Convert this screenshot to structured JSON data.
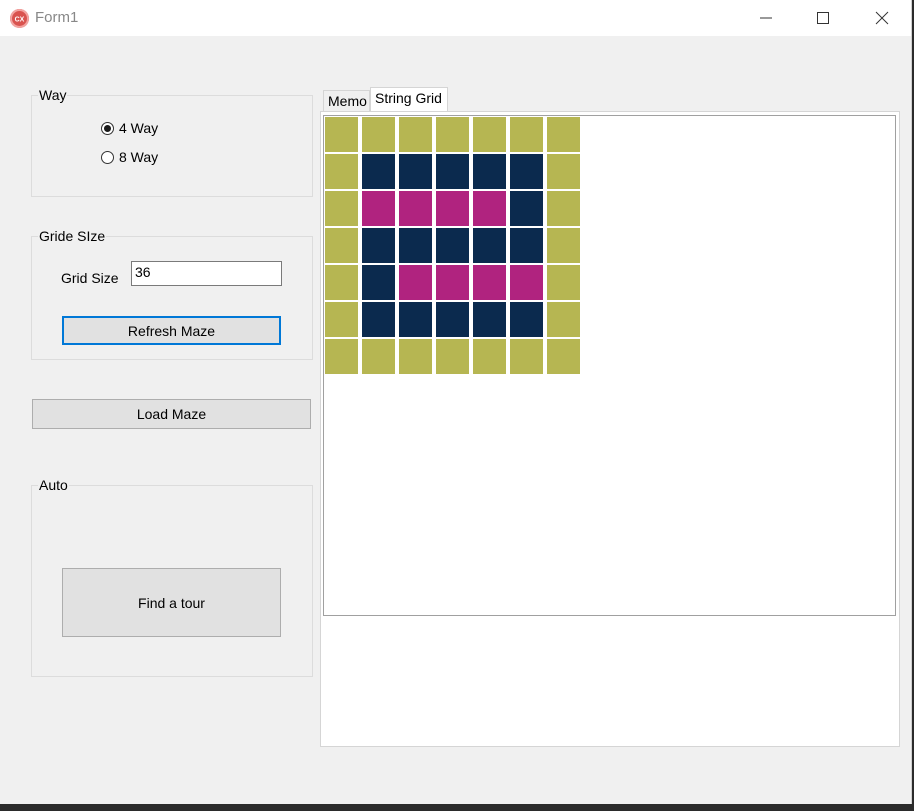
{
  "window": {
    "title": "Form1",
    "icon": "cx-app-icon"
  },
  "controls": {
    "minimize": "minimize-icon",
    "maximize": "maximize-icon",
    "close": "close-icon"
  },
  "way_group": {
    "label": "Way",
    "options": [
      {
        "label": "4 Way",
        "selected": true
      },
      {
        "label": "8 Way",
        "selected": false
      }
    ]
  },
  "size_group": {
    "label": "Gride SIze",
    "field_label": "Grid Size",
    "field_value": "36",
    "refresh_label": "Refresh Maze"
  },
  "load_label": "Load Maze",
  "auto_group": {
    "label": "Auto",
    "find_label": "Find a tour"
  },
  "tabs": [
    {
      "label": "Memo",
      "active": false
    },
    {
      "label": "String Grid",
      "active": true
    }
  ],
  "colors": {
    "wall": "#b6b652",
    "path": "#0b2a4e",
    "visited": "#b0237f",
    "accent": "#0078d7"
  },
  "maze": [
    [
      "W",
      "W",
      "W",
      "W",
      "W",
      "W",
      "W"
    ],
    [
      "W",
      "P",
      "P",
      "P",
      "P",
      "P",
      "W"
    ],
    [
      "W",
      "V",
      "V",
      "V",
      "V",
      "P",
      "W"
    ],
    [
      "W",
      "P",
      "P",
      "P",
      "P",
      "P",
      "W"
    ],
    [
      "W",
      "P",
      "V",
      "V",
      "V",
      "V",
      "W"
    ],
    [
      "W",
      "P",
      "P",
      "P",
      "P",
      "P",
      "W"
    ],
    [
      "W",
      "W",
      "W",
      "W",
      "W",
      "W",
      "W"
    ]
  ]
}
